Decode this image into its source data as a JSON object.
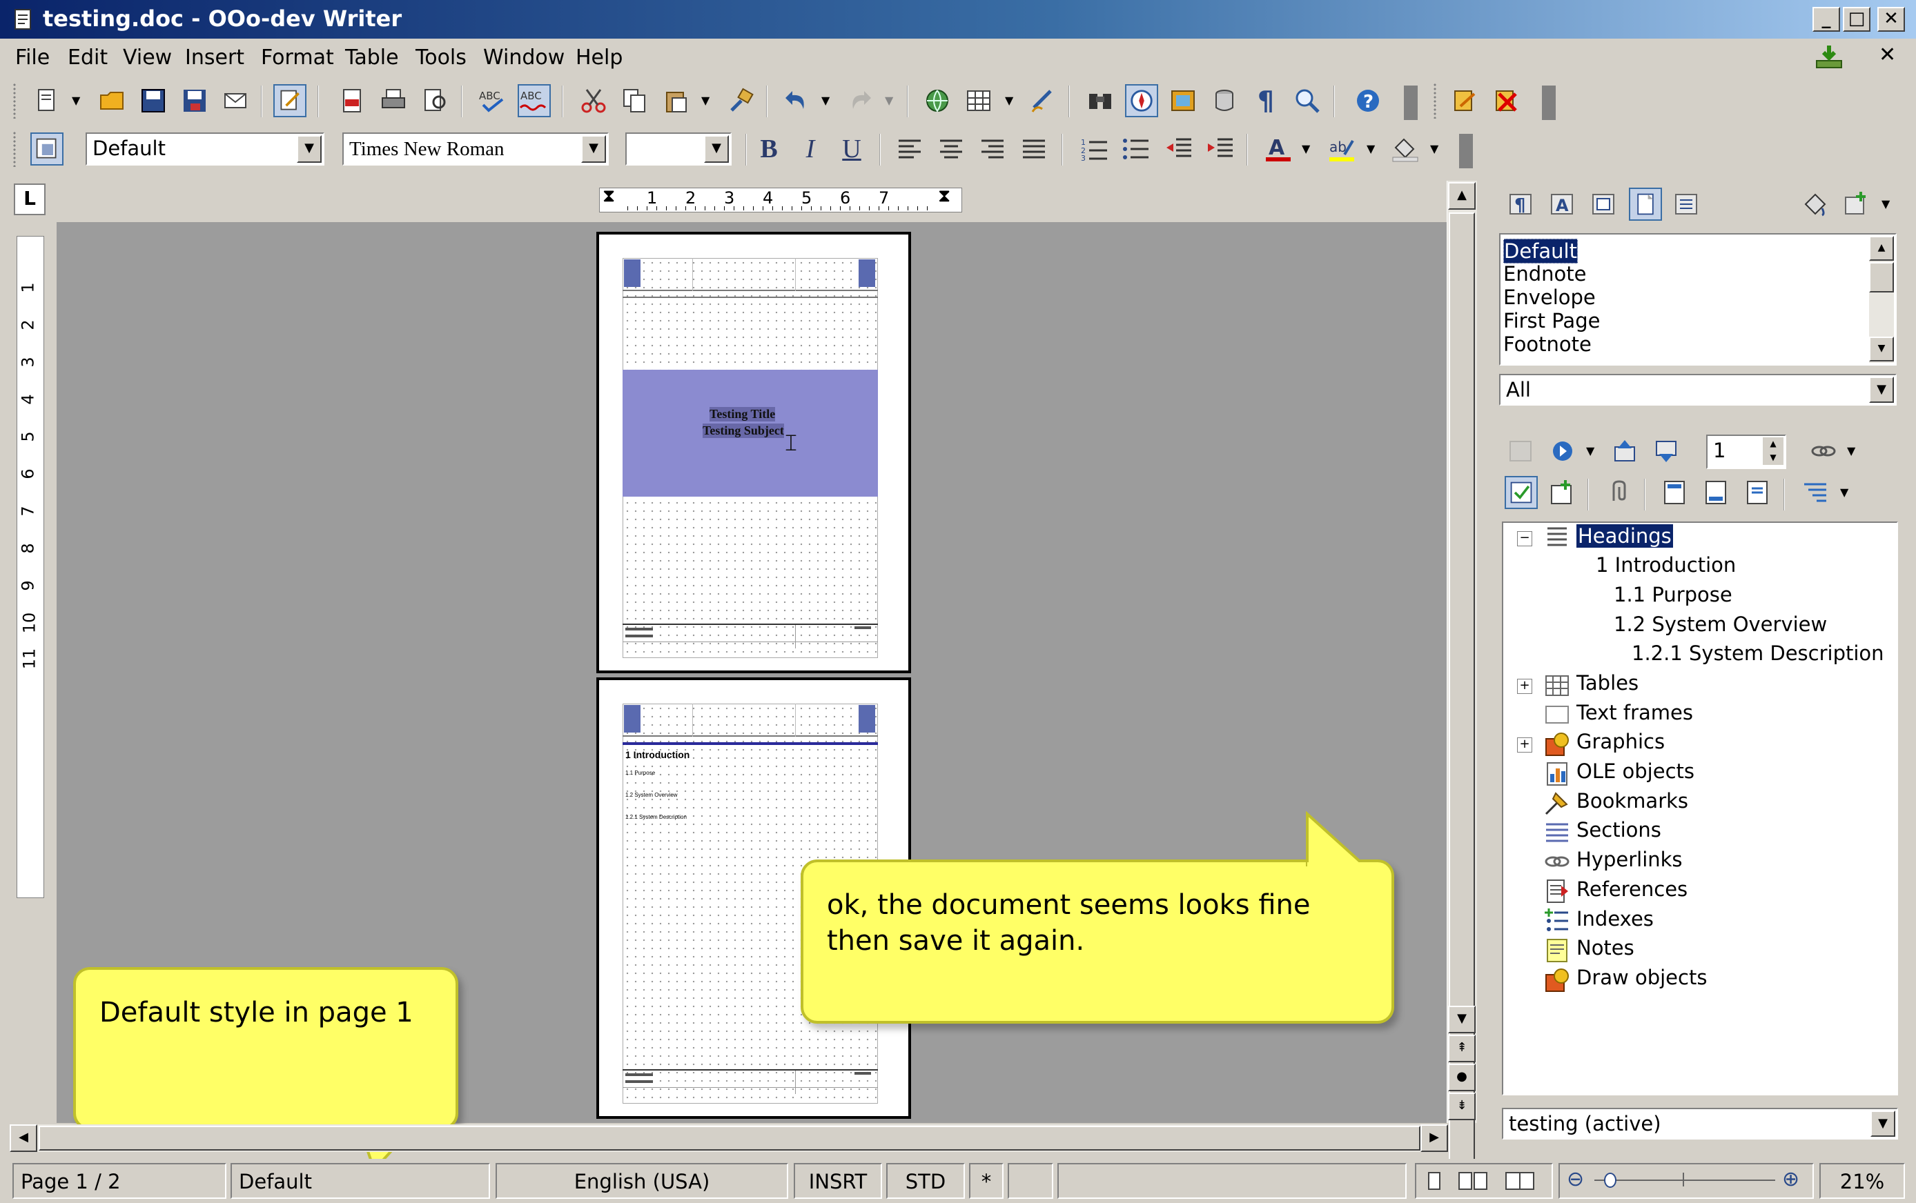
{
  "window": {
    "title": "testing.doc - OOo-dev Writer",
    "minimize": "_",
    "maximize": "□",
    "close": "✕"
  },
  "menu": [
    "File",
    "Edit",
    "View",
    "Insert",
    "Format",
    "Table",
    "Tools",
    "Window",
    "Help"
  ],
  "formatting": {
    "paragraph_style": "Default",
    "font_name": "Times New Roman",
    "font_size": "",
    "bold": "B",
    "italic": "I",
    "underline": "U"
  },
  "ruler": {
    "corner": "L",
    "h_marks": [
      "1",
      "2",
      "3",
      "4",
      "5",
      "6",
      "7"
    ],
    "v_marks": [
      "1",
      "2",
      "3",
      "4",
      "5",
      "6",
      "7",
      "8",
      "9",
      "10",
      "11"
    ]
  },
  "document": {
    "page1": {
      "title_line1": "Testing Title",
      "title_line2": "Testing Subject"
    },
    "page2": {
      "heading": "1 Introduction",
      "items": [
        "1.1 Purpose",
        "1.2 System Overview",
        "1.2.1 System Description"
      ]
    }
  },
  "callouts": {
    "right": "ok, the document seems looks fine then save it again.",
    "left": "Default style in page 1"
  },
  "stylist": {
    "styles": [
      "Default",
      "Endnote",
      "Envelope",
      "First Page",
      "Footnote"
    ],
    "filter": "All"
  },
  "navigator": {
    "page_number": "1",
    "tree": [
      {
        "label": "Headings",
        "level": 0,
        "icon": "headings-icon",
        "expander": "−",
        "selected": true
      },
      {
        "label": "1  Introduction",
        "level": 1
      },
      {
        "label": "1.1  Purpose",
        "level": 2
      },
      {
        "label": "1.2  System Overview",
        "level": 2
      },
      {
        "label": "1.2.1  System Description",
        "level": 3
      },
      {
        "label": "Tables",
        "level": 0,
        "icon": "tables-icon",
        "expander": "+"
      },
      {
        "label": "Text frames",
        "level": 0,
        "icon": "text-frames-icon"
      },
      {
        "label": "Graphics",
        "level": 0,
        "icon": "graphics-icon",
        "expander": "+"
      },
      {
        "label": "OLE objects",
        "level": 0,
        "icon": "ole-objects-icon"
      },
      {
        "label": "Bookmarks",
        "level": 0,
        "icon": "bookmarks-icon"
      },
      {
        "label": "Sections",
        "level": 0,
        "icon": "sections-icon"
      },
      {
        "label": "Hyperlinks",
        "level": 0,
        "icon": "hyperlinks-icon"
      },
      {
        "label": "References",
        "level": 0,
        "icon": "references-icon"
      },
      {
        "label": "Indexes",
        "level": 0,
        "icon": "indexes-icon"
      },
      {
        "label": "Notes",
        "level": 0,
        "icon": "notes-icon"
      },
      {
        "label": "Draw objects",
        "level": 0,
        "icon": "draw-objects-icon"
      }
    ],
    "document": "testing (active)"
  },
  "status": {
    "page": "Page 1 / 2",
    "style": "Default",
    "language": "English (USA)",
    "insert_mode": "INSRT",
    "selection_mode": "STD",
    "modified": "*",
    "zoom": "21%"
  },
  "colors": {
    "title_bar": "#0a246a",
    "page_header_band": "#8b8bd0",
    "callout_fill": "#ffff66",
    "selection": "#0a246a"
  }
}
